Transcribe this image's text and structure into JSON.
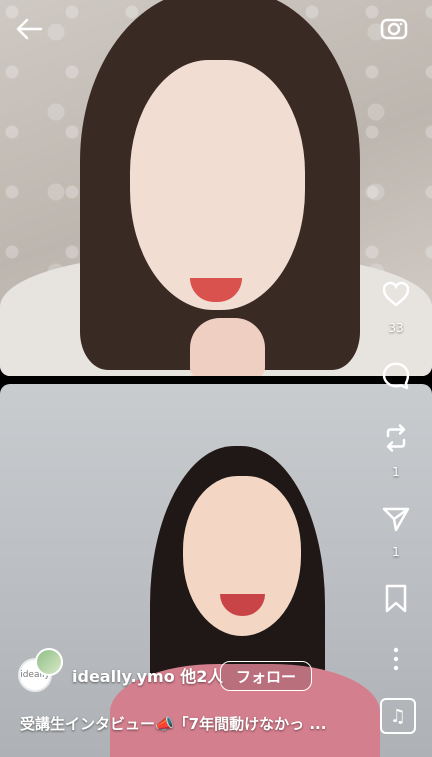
{
  "header": {
    "back_icon": "back-arrow-icon",
    "camera_icon": "camera-icon"
  },
  "interactions": {
    "like": {
      "icon": "heart-icon",
      "count": "33"
    },
    "comment": {
      "icon": "comment-icon"
    },
    "remix": {
      "icon": "repost-icon",
      "count": "1"
    },
    "share": {
      "icon": "send-icon",
      "count": "1"
    },
    "save": {
      "icon": "bookmark-icon"
    },
    "more": {
      "icon": "more-icon"
    },
    "music": {
      "icon": "music-note-icon"
    }
  },
  "footer": {
    "username": "ideally.ymo 他2人",
    "follow_label": "フォロー",
    "caption": "受講生インタビュー📣「7年間動けなかっ ...",
    "avatar_text": "ideally"
  },
  "colors": {
    "text": "#ffffff",
    "accent": "#ffffff"
  }
}
